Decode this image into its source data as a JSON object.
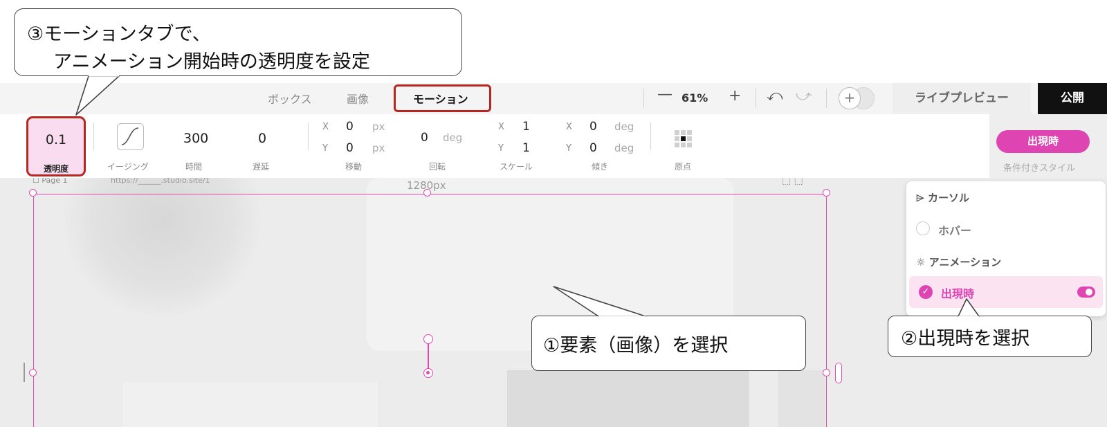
{
  "annotations": {
    "step3_line1": "③モーションタブで、",
    "step3_line2": "アニメーション開始時の透明度を設定",
    "step1": "①要素（画像）を選択",
    "step2": "②出現時を選択"
  },
  "toolbar": {
    "tabs": [
      {
        "label": "ボックス",
        "active": false
      },
      {
        "label": "画像",
        "active": false
      },
      {
        "label": "モーション",
        "active": true
      }
    ],
    "zoom_out_symbol": "—",
    "zoom_level": "61%",
    "zoom_in_symbol": "+",
    "undo_symbol": "⤺",
    "redo_symbol": "⤻",
    "add_symbol": "+",
    "live_preview": "ライブプレビュー",
    "publish": "公開"
  },
  "motion": {
    "opacity": {
      "value": "0.1",
      "label": "透明度"
    },
    "easing": {
      "label": "イージング"
    },
    "duration": {
      "value": "300",
      "label": "時間"
    },
    "delay": {
      "value": "0",
      "label": "遅延"
    },
    "move": {
      "x_axis": "X",
      "x": "0",
      "x_unit": "px",
      "y_axis": "Y",
      "y": "0",
      "y_unit": "px",
      "label": "移動"
    },
    "rotate": {
      "value": "0",
      "unit": "deg",
      "label": "回転"
    },
    "scale": {
      "x_axis": "X",
      "x": "1",
      "y_axis": "Y",
      "y": "1",
      "label": "スケール"
    },
    "skew": {
      "x_axis": "X",
      "x": "0",
      "x_unit": "deg",
      "y_axis": "Y",
      "y": "0",
      "y_unit": "deg",
      "label": "傾き"
    },
    "origin": {
      "label": "原点"
    }
  },
  "condition": {
    "button": "出現時",
    "sub_label": "条件付きスタイル"
  },
  "dropdown": {
    "cursor_section": "カーソル",
    "hover": "ホバー",
    "animation_section": "アニメーション",
    "appear": "出現時"
  },
  "canvas": {
    "page_tab": "☐ Page 1",
    "url": "https://______.studio.site/1",
    "width_label": "1280px"
  },
  "colors": {
    "accent": "#de44b2",
    "annotation_red": "#b5281f",
    "publish_bg": "#111111"
  }
}
